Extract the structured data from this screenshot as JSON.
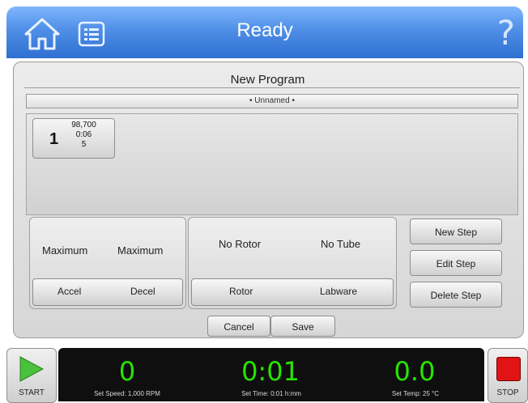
{
  "header": {
    "title": "Ready",
    "icons": [
      "home-icon",
      "list-icon",
      "help-icon"
    ],
    "help_glyph": "?"
  },
  "program": {
    "title": "New Program",
    "name": "• Unnamed •",
    "steps": [
      {
        "number": "1",
        "speed": "98,700",
        "time": "0:06",
        "extra": "5"
      }
    ]
  },
  "accel": {
    "accel_value": "Maximum",
    "decel_value": "Maximum",
    "accel_label": "Accel",
    "decel_label": "Decel"
  },
  "rotor": {
    "rotor_value": "No Rotor",
    "tube_value": "No Tube",
    "rotor_label": "Rotor",
    "labware_label": "Labware"
  },
  "actions": {
    "new_step": "New Step",
    "edit_step": "Edit Step",
    "delete_step": "Delete Step",
    "cancel": "Cancel",
    "save": "Save"
  },
  "status": {
    "speed": "0",
    "time": "0:01",
    "temp": "0.0",
    "set_speed": "Set Speed: 1,000 RPM",
    "set_time": "Set Time: 0:01 h:mm",
    "set_temp": "Set Temp: 25 °C",
    "start": "START",
    "stop": "STOP"
  },
  "colors": {
    "header_blue": "#2e6fd1",
    "lcd_green": "#27e600",
    "stop_red": "#e01414",
    "start_green": "#49c23b"
  }
}
